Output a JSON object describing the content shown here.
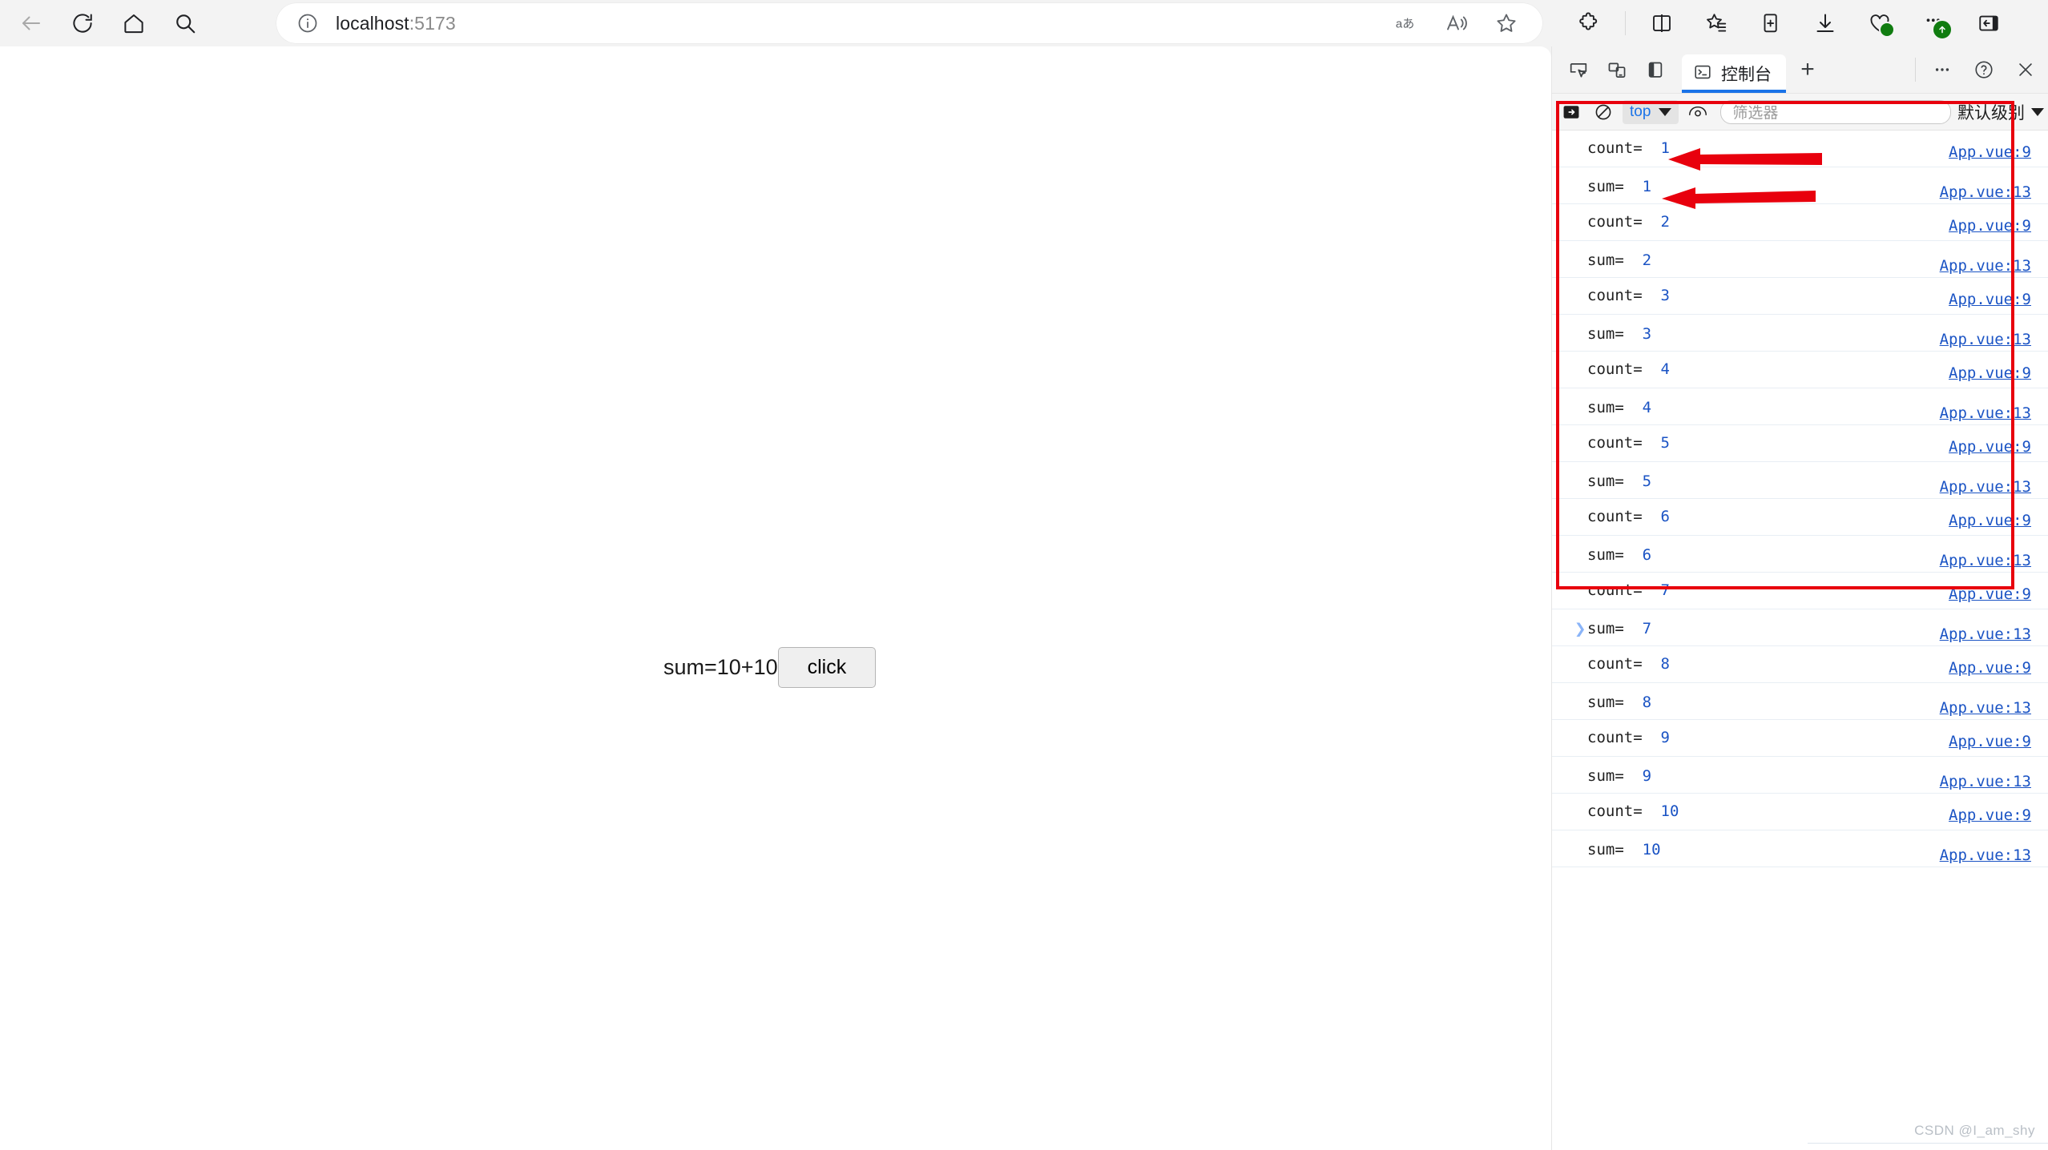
{
  "browser": {
    "nav_icons": [
      {
        "name": "back-icon",
        "label": "Back"
      },
      {
        "name": "refresh-icon",
        "label": "Refresh"
      },
      {
        "name": "home-icon",
        "label": "Home"
      },
      {
        "name": "search-icon",
        "label": "Search"
      }
    ],
    "address_bar": {
      "info_icon": "info-icon",
      "url_host": "localhost",
      "url_port": ":5173",
      "inline_icons": [
        {
          "name": "translate-icon",
          "glyph": "aあ"
        },
        {
          "name": "read-aloud-icon",
          "glyph": "A"
        },
        {
          "name": "favorite-star-icon",
          "glyph": "star"
        }
      ]
    },
    "toolbar_icons": [
      {
        "name": "extensions-icon",
        "label": "Extensions"
      },
      {
        "name": "split-screen-icon",
        "label": "Split screen"
      },
      {
        "name": "collections-icon",
        "label": "Collections"
      },
      {
        "name": "add-tab-to-collection-icon",
        "label": "Add to collection"
      },
      {
        "name": "downloads-icon",
        "label": "Downloads"
      },
      {
        "name": "browser-essentials-icon",
        "label": "Browser essentials"
      },
      {
        "name": "settings-more-icon",
        "label": "Settings and more"
      },
      {
        "name": "sidebar-toggle-icon",
        "label": "Toggle sidebar"
      }
    ]
  },
  "page": {
    "sum_text": "sum=10+10",
    "button_label": "click"
  },
  "devtools": {
    "header_icons": [
      {
        "name": "inspect-element-icon",
        "label": "Inspect"
      },
      {
        "name": "device-toolbar-icon",
        "label": "Device toolbar"
      },
      {
        "name": "dock-side-icon",
        "label": "Dock side"
      }
    ],
    "tab": {
      "icon": "console-terminal-icon",
      "label": "控制台"
    },
    "new_tab_label": "+",
    "right_icons": [
      {
        "name": "more-options-icon",
        "label": "..."
      },
      {
        "name": "help-icon",
        "label": "?"
      },
      {
        "name": "close-devtools-icon",
        "label": "×"
      }
    ],
    "console_toolbar": {
      "sidebar_icon": "console-sidebar-icon",
      "clear_icon": "clear-console-icon",
      "context_value": "top",
      "eye_icon": "live-expression-icon",
      "filter_placeholder": "筛选器",
      "level_value": "默认级别"
    },
    "console_logs": [
      {
        "kind": "count",
        "label": "count=",
        "value": "1",
        "source": "App.vue:9"
      },
      {
        "kind": "sum",
        "label": "sum=",
        "value": "1",
        "source": "App.vue:13"
      },
      {
        "kind": "count",
        "label": "count=",
        "value": "2",
        "source": "App.vue:9"
      },
      {
        "kind": "sum",
        "label": "sum=",
        "value": "2",
        "source": "App.vue:13"
      },
      {
        "kind": "count",
        "label": "count=",
        "value": "3",
        "source": "App.vue:9"
      },
      {
        "kind": "sum",
        "label": "sum=",
        "value": "3",
        "source": "App.vue:13"
      },
      {
        "kind": "count",
        "label": "count=",
        "value": "4",
        "source": "App.vue:9"
      },
      {
        "kind": "sum",
        "label": "sum=",
        "value": "4",
        "source": "App.vue:13"
      },
      {
        "kind": "count",
        "label": "count=",
        "value": "5",
        "source": "App.vue:9"
      },
      {
        "kind": "sum",
        "label": "sum=",
        "value": "5",
        "source": "App.vue:13"
      },
      {
        "kind": "count",
        "label": "count=",
        "value": "6",
        "source": "App.vue:9"
      },
      {
        "kind": "sum",
        "label": "sum=",
        "value": "6",
        "source": "App.vue:13"
      },
      {
        "kind": "count",
        "label": "count=",
        "value": "7",
        "source": "App.vue:9"
      },
      {
        "kind": "sum",
        "label": "sum=",
        "value": "7",
        "source": "App.vue:13"
      },
      {
        "kind": "count",
        "label": "count=",
        "value": "8",
        "source": "App.vue:9"
      },
      {
        "kind": "sum",
        "label": "sum=",
        "value": "8",
        "source": "App.vue:13"
      },
      {
        "kind": "count",
        "label": "count=",
        "value": "9",
        "source": "App.vue:9"
      },
      {
        "kind": "sum",
        "label": "sum=",
        "value": "9",
        "source": "App.vue:13"
      },
      {
        "kind": "count",
        "label": "count=",
        "value": "10",
        "source": "App.vue:9"
      },
      {
        "kind": "sum",
        "label": "sum=",
        "value": "10",
        "source": "App.vue:13"
      }
    ],
    "prompt_chevron": "❯"
  },
  "annotations": {
    "box_color": "#e8000d",
    "arrow_color": "#e8000d",
    "arrows": [
      {
        "name": "arrow-pointing-count-value"
      },
      {
        "name": "arrow-pointing-sum-value"
      }
    ]
  },
  "watermark": "CSDN @I_am_shy"
}
